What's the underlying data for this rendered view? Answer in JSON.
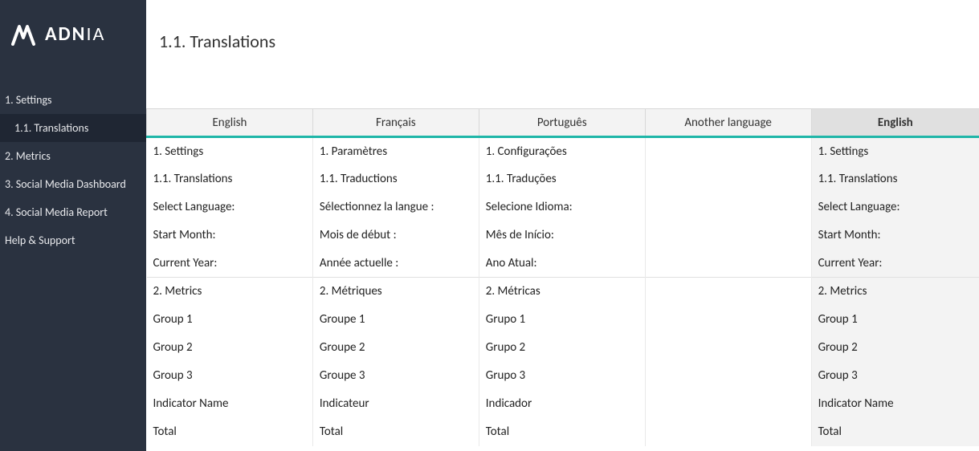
{
  "brand": {
    "name_bold": "ADN",
    "name_thin": "IA"
  },
  "sidebar": {
    "items": [
      {
        "label": "1. Settings",
        "active": false,
        "sub": false
      },
      {
        "label": "1.1. Translations",
        "active": true,
        "sub": true
      },
      {
        "label": "2. Metrics",
        "active": false,
        "sub": false
      },
      {
        "label": "3. Social Media Dashboard",
        "active": false,
        "sub": false
      },
      {
        "label": "4. Social Media Report",
        "active": false,
        "sub": false
      },
      {
        "label": "Help & Support",
        "active": false,
        "sub": false
      }
    ]
  },
  "page": {
    "title": "1.1. Translations"
  },
  "table": {
    "headers": [
      "English",
      "Français",
      "Português",
      "Another language",
      "English"
    ],
    "rows": [
      {
        "sep": false,
        "cells": [
          "1. Settings",
          "1. Paramètres",
          "1. Configurações",
          "",
          "1. Settings"
        ]
      },
      {
        "sep": false,
        "cells": [
          "1.1. Translations",
          "1.1. Traductions",
          "1.1. Traduções",
          "",
          "1.1. Translations"
        ]
      },
      {
        "sep": false,
        "cells": [
          "Select Language:",
          "Sélectionnez la langue :",
          "Selecione Idioma:",
          "",
          "Select Language:"
        ]
      },
      {
        "sep": false,
        "cells": [
          "Start Month:",
          "Mois de début :",
          "Mês de Início:",
          "",
          "Start Month:"
        ]
      },
      {
        "sep": false,
        "cells": [
          "Current Year:",
          "Année actuelle :",
          "Ano Atual:",
          "",
          "Current Year:"
        ]
      },
      {
        "sep": true,
        "cells": [
          "2. Metrics",
          "2. Métriques",
          "2. Métricas",
          "",
          "2. Metrics"
        ]
      },
      {
        "sep": false,
        "cells": [
          "Group 1",
          "Groupe 1",
          "Grupo 1",
          "",
          "Group 1"
        ]
      },
      {
        "sep": false,
        "cells": [
          "Group 2",
          "Groupe 2",
          "Grupo 2",
          "",
          "Group 2"
        ]
      },
      {
        "sep": false,
        "cells": [
          "Group 3",
          "Groupe 3",
          "Grupo 3",
          "",
          "Group 3"
        ]
      },
      {
        "sep": false,
        "cells": [
          "Indicator Name",
          "Indicateur",
          "Indicador",
          "",
          "Indicator Name"
        ]
      },
      {
        "sep": false,
        "cells": [
          "Total",
          "Total",
          "Total",
          "",
          "Total"
        ]
      }
    ]
  }
}
